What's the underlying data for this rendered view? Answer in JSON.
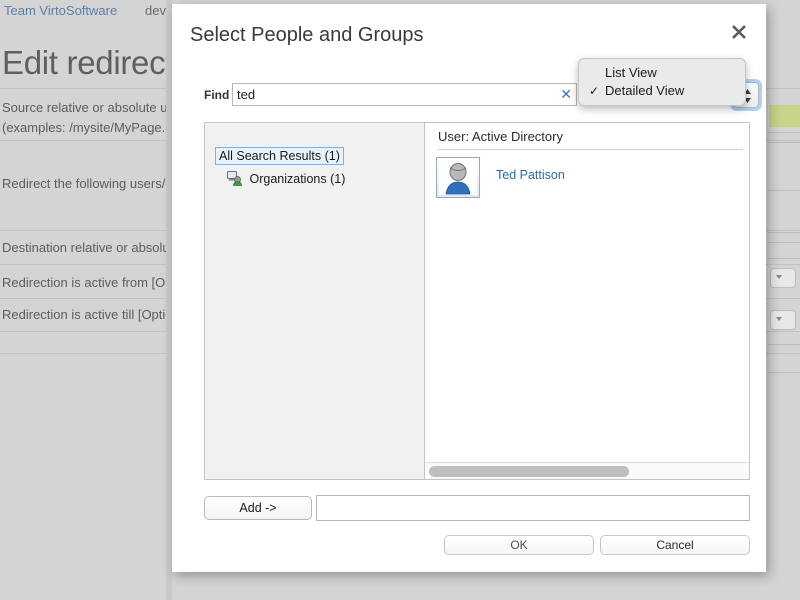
{
  "background": {
    "brand": "Team VirtoSoftware",
    "env": "dev",
    "heading": "Edit redirect",
    "form_labels": [
      "Source relative or absolute ur",
      "(examples: /mysite/MyPage.a",
      "Redirect the following users/g",
      "Destination relative or absolut",
      "Redirection is active from [Op",
      "Redirection is active till [Optio"
    ]
  },
  "dialog": {
    "title": "Select People and Groups",
    "close_icon": "close-icon",
    "find": {
      "label": "Find",
      "value": "ted",
      "placeholder": "",
      "clear_icon": "clear-icon"
    },
    "view_select": {
      "icon": "updown-arrows-icon",
      "selected": "Detailed View"
    },
    "view_menu": {
      "items": [
        {
          "label": "List View",
          "checked": false,
          "check_glyph": ""
        },
        {
          "label": "Detailed View",
          "checked": true,
          "check_glyph": "✓"
        }
      ]
    },
    "tree": {
      "root_label": "All Search Results (1)",
      "child_label": "Organizations (1)",
      "child_icon": "organizations-icon"
    },
    "results": {
      "header": "User: Active Directory",
      "items": [
        {
          "name": "Ted Pattison",
          "avatar_icon": "user-avatar-icon"
        }
      ]
    },
    "add_row": {
      "add_label": "Add ->",
      "selected_value": "",
      "selected_placeholder": ""
    },
    "footer": {
      "ok_label": "OK",
      "cancel_label": "Cancel"
    }
  },
  "colors": {
    "accent_link": "#2b6ca8",
    "brand_link": "#5b7fa6",
    "selection_border": "#76b4e8",
    "focus_ring": "#6eaaeb",
    "page_bg": "#d4d4d4",
    "green_chip": "#c9d38a"
  }
}
